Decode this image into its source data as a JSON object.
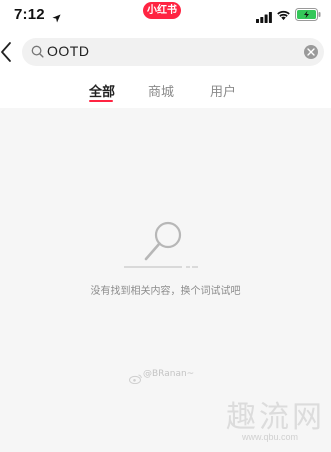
{
  "status_bar": {
    "time": "7:12",
    "app_badge": "小红书"
  },
  "search": {
    "query": "OOTD"
  },
  "tabs": [
    {
      "label": "全部",
      "active": true
    },
    {
      "label": "商城",
      "active": false
    },
    {
      "label": "用户",
      "active": false
    }
  ],
  "empty_state": {
    "message": "没有找到相关内容，换个词试试吧"
  },
  "watermark": {
    "user": "@BRanan~",
    "site_logo": "趣流网",
    "site_url": "www.qbu.com"
  },
  "colors": {
    "accent": "#ff2442",
    "background": "#f6f6f6"
  }
}
